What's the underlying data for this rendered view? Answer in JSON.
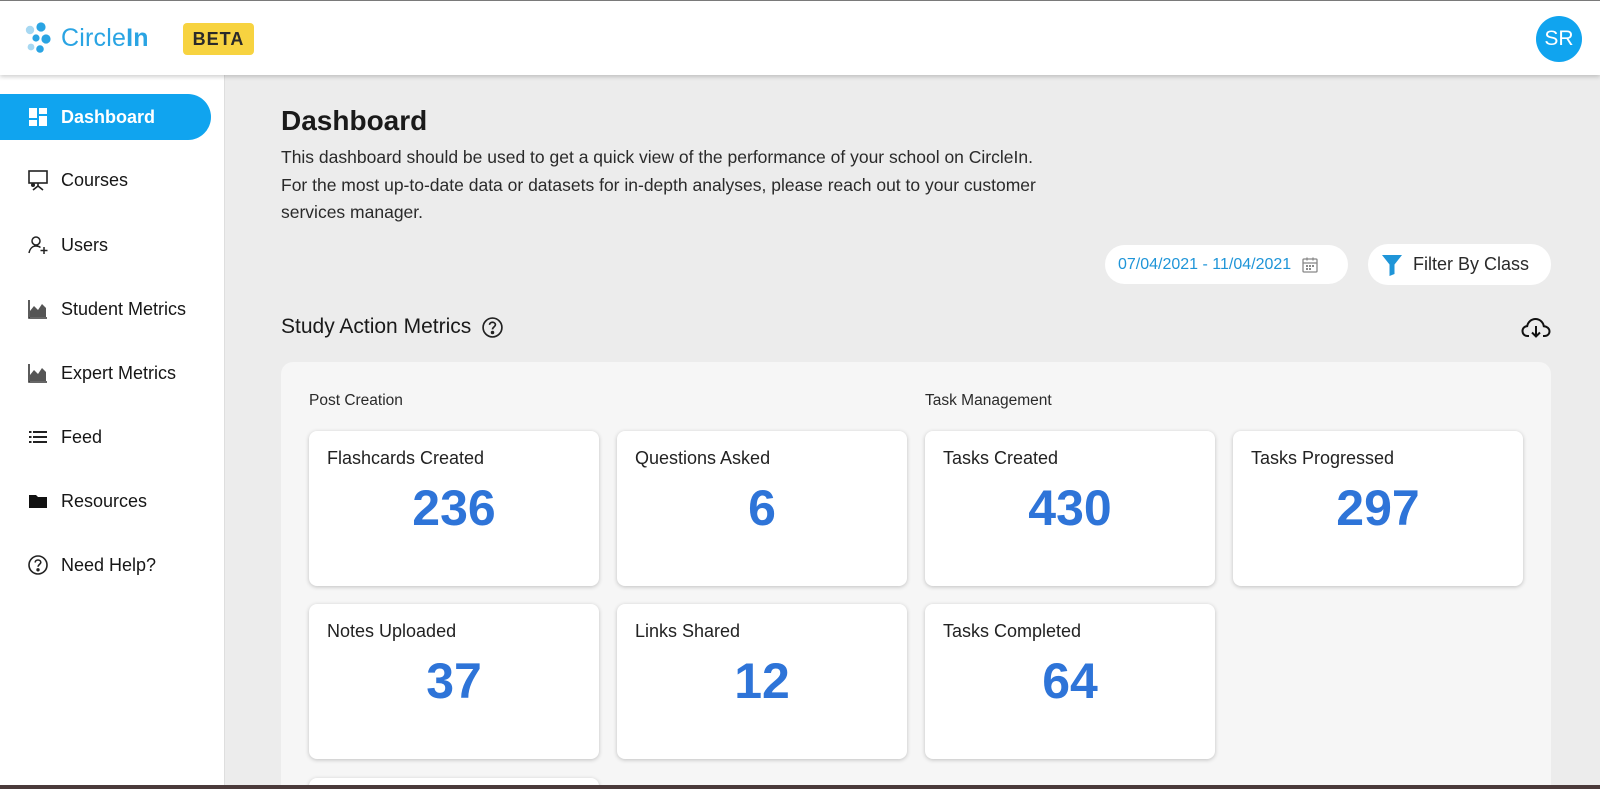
{
  "header": {
    "brand_light": "Circle",
    "brand_bold": "In",
    "beta": "BETA",
    "avatar_initials": "SR",
    "accent_color": "#10a4ef"
  },
  "sidebar": {
    "items": [
      {
        "label": "Dashboard",
        "icon": "dashboard-icon",
        "active": true
      },
      {
        "label": "Courses",
        "icon": "presentation-board-icon",
        "active": false
      },
      {
        "label": "Users",
        "icon": "users-icon",
        "active": false
      },
      {
        "label": "Student Metrics",
        "icon": "area-chart-icon",
        "active": false
      },
      {
        "label": "Expert Metrics",
        "icon": "area-chart-icon",
        "active": false
      },
      {
        "label": "Feed",
        "icon": "list-icon",
        "active": false
      },
      {
        "label": "Resources",
        "icon": "folder-icon",
        "active": false
      },
      {
        "label": "Need Help?",
        "icon": "help-circle-icon",
        "active": false
      }
    ]
  },
  "main": {
    "title": "Dashboard",
    "description": "This dashboard should be used to get a quick view of the performance of your school on CircleIn. For the most up-to-date data or datasets for in-depth analyses, please reach out to your customer services manager.",
    "date_range": "07/04/2021 - 11/04/2021",
    "filter_label": "Filter By Class",
    "section_title": "Study Action Metrics",
    "groups": {
      "post_creation": "Post Creation",
      "task_management": "Task Management"
    },
    "cards": [
      {
        "label": "Flashcards Created",
        "value": "236"
      },
      {
        "label": "Questions Asked",
        "value": "6"
      },
      {
        "label": "Tasks Created",
        "value": "430"
      },
      {
        "label": "Tasks Progressed",
        "value": "297"
      },
      {
        "label": "Notes Uploaded",
        "value": "37"
      },
      {
        "label": "Links Shared",
        "value": "12"
      },
      {
        "label": "Tasks Completed",
        "value": "64"
      }
    ]
  }
}
